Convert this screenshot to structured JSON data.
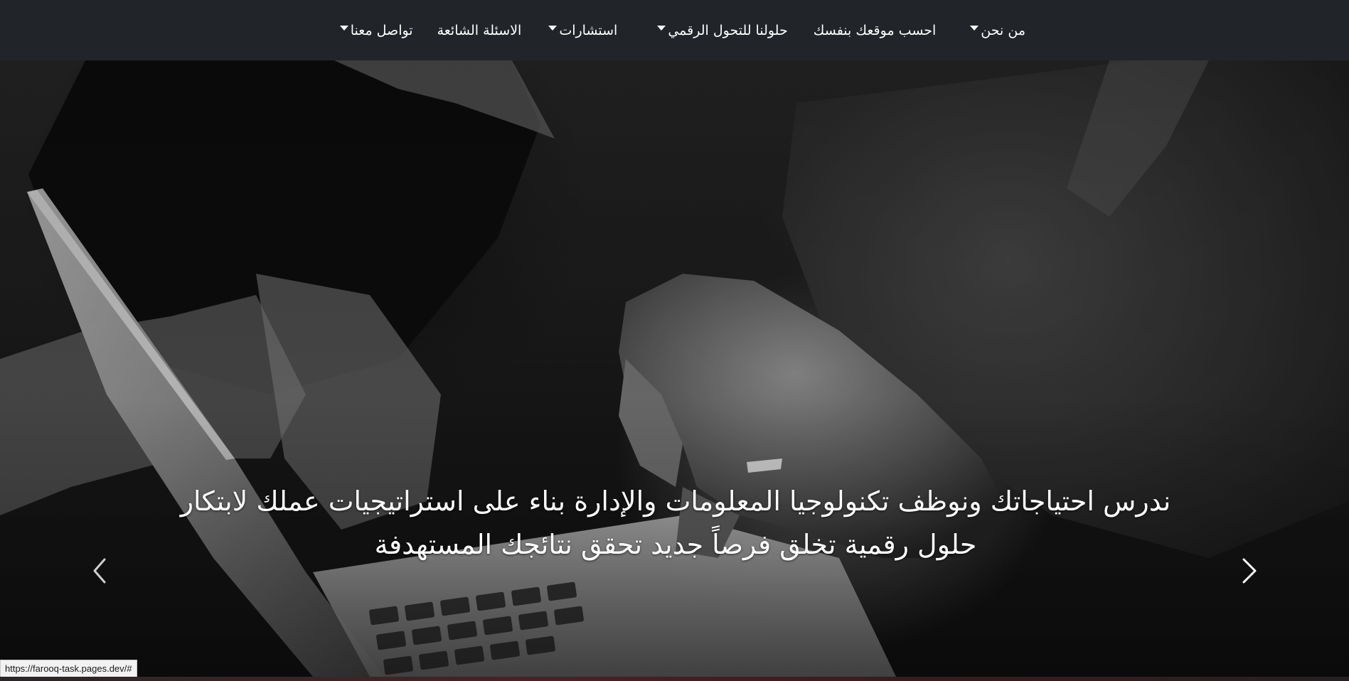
{
  "navbar": {
    "items": [
      {
        "label": "من نحن",
        "has_dropdown": true
      },
      {
        "label": "احسب موقعك بنفسك",
        "has_dropdown": false
      },
      {
        "label": "حلولنا للتحول الرقمي",
        "has_dropdown": true
      },
      {
        "label": "استشارات",
        "has_dropdown": true
      },
      {
        "label": "الاسئلة الشائعة",
        "has_dropdown": false
      },
      {
        "label": "تواصل معنا",
        "has_dropdown": true
      }
    ]
  },
  "hero": {
    "caption": "ندرس احتياجاتك ونوظف تكنولوجيا المعلومات والإدارة بناء على استراتيجيات عملك لابتكار حلول رقمية تخلق فرصاً جديد تحقق نتائجك المستهدفة",
    "prev_icon": "chevron-left-icon",
    "next_icon": "chevron-right-icon"
  },
  "status_bar": {
    "url": "https://farooq-task.pages.dev/#"
  },
  "colors": {
    "navbar_bg": "#212529",
    "nav_text": "#ffffff"
  }
}
